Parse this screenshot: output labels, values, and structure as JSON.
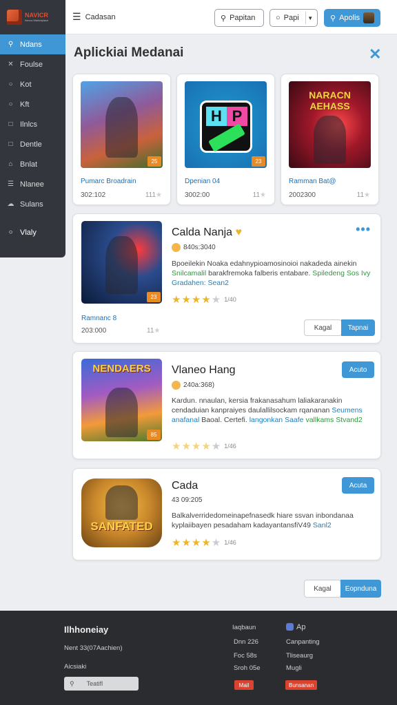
{
  "app": {
    "logo_line1": "NAVICR",
    "logo_line2": "Nexus Marketplace"
  },
  "sidebar": {
    "items": [
      {
        "label": "Ndans",
        "icon": "search-icon",
        "active": true
      },
      {
        "label": "Foulse",
        "icon": "tools-icon"
      },
      {
        "label": "Kot",
        "icon": "circle-icon"
      },
      {
        "label": "Kft",
        "icon": "circle-icon"
      },
      {
        "label": "Ilnlcs",
        "icon": "square-icon"
      },
      {
        "label": "Dentle",
        "icon": "square-icon"
      },
      {
        "label": "Bnlat",
        "icon": "trash-icon"
      },
      {
        "label": "Nlanee",
        "icon": "list-icon"
      },
      {
        "label": "Sulans",
        "icon": "cloud-icon"
      }
    ],
    "bottom_item": {
      "label": "Vlaly",
      "icon": "search-icon"
    }
  },
  "topbar": {
    "title": "Cadasan",
    "search_label": "Papitan",
    "select_label": "Papi",
    "action_label": "Apolis"
  },
  "page": {
    "title": "Aplickiai Medanai"
  },
  "small_cards": [
    {
      "name": "Pumarc Broadrain",
      "meta": "302:102",
      "count": "111",
      "badge": "25"
    },
    {
      "name": "Dpenian 04",
      "meta": "3002:00",
      "count": "11",
      "badge": "23"
    },
    {
      "name": "Ramman Bat@",
      "meta": "2002300",
      "count": "11",
      "badge": "",
      "art_text": "NARACN AEHASS"
    }
  ],
  "big_cards": [
    {
      "title": "Calda Nanja",
      "sub": "840s:3040",
      "desc_plain": "Bpoeilekin Noaka edahnypioamosinoioi nakadeda ainekin",
      "desc_hl": "Snilcamalil",
      "desc_plain2": "barakfremoka falberis entabare.",
      "desc_link": "Spiledeng Sos",
      "desc_link2": "Ivy",
      "desc_link3": "Gradahen: Sean2",
      "rating": 4,
      "rating_count": "1/40",
      "thumb_name": "Ramnanc 8",
      "thumb_meta": "203:000",
      "thumb_count": "11",
      "badge": "23",
      "btn_secondary": "Kagal",
      "btn_primary": "Tapnai"
    },
    {
      "title": "Vlaneo Hang",
      "sub": "240a:368)",
      "desc": "Kardun. nnaulan, kersia frakanasahum laliakaranakin cendaduian kanpraiyes daulallilsockam rqananan",
      "desc_hl": "Seumens anafanal",
      "desc_mid": "Baoal. Certefi.",
      "desc_hl2": "langonkan Saafe",
      "desc_tail": "vallkams Stvand2",
      "rating": 4,
      "rating_count": "1/46",
      "badge": "85",
      "art_text": "NENDAERS",
      "btn_primary": "Acuto"
    },
    {
      "title": "Cada",
      "sub": "43 09:205",
      "desc": "Balkalverridedomeinapefnasedk hiare ssvan inbondanaa kyplaiibayen pesadaham kadayantansfiV49",
      "desc_hl": "Sanl2",
      "rating": 4,
      "rating_count": "1/46",
      "art_text": "SANFATED",
      "btn_primary": "Acuta"
    }
  ],
  "bottom_buttons": {
    "secondary": "Kagal",
    "primary": "Eopnduna"
  },
  "footer": {
    "title": "Ilhhoneiay",
    "line1": "Nent 33(07Aachien)",
    "line2": "Aicsiaki",
    "input_label": "Teatifl",
    "col2": [
      "Iaqbaun",
      "Dnn 226",
      "Foc 58s",
      "Sroh 05e"
    ],
    "col3_title": "Ap",
    "col3": [
      "Canpanting",
      "Tliseaurg",
      "Mugli"
    ],
    "tag1": "Mail",
    "tag2": "Bunsanan"
  },
  "colors": {
    "accent": "#3f97d6",
    "sidebar_bg": "#33373d",
    "footer_bg": "#2b2c2f",
    "star": "#f0b428"
  }
}
